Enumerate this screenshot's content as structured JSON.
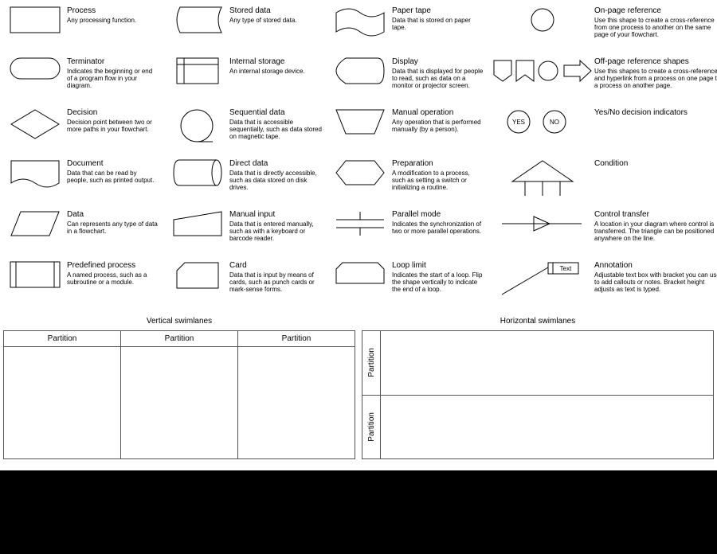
{
  "col1": [
    {
      "title": "Process",
      "desc": "Any processing function."
    },
    {
      "title": "Terminator",
      "desc": "Indicates the beginning or end of a program flow in your diagram."
    },
    {
      "title": "Decision",
      "desc": "Decision point between two or more paths in your flowchart."
    },
    {
      "title": "Document",
      "desc": "Data that can be read by people, such as printed output."
    },
    {
      "title": "Data",
      "desc": "Can represents any type of data in a flowchart."
    },
    {
      "title": "Predefined process",
      "desc": "A named process, such as a subroutine or a module."
    }
  ],
  "col2": [
    {
      "title": "Stored data",
      "desc": "Any type of stored data."
    },
    {
      "title": "Internal storage",
      "desc": "An internal storage device."
    },
    {
      "title": "Sequential data",
      "desc": "Data that is accessible sequentially, such as data stored on magnetic tape."
    },
    {
      "title": "Direct data",
      "desc": "Data that is directly accessible, such as data stored on disk drives."
    },
    {
      "title": "Manual input",
      "desc": "Data that is entered manually, such as with a keyboard or barcode reader."
    },
    {
      "title": "Card",
      "desc": "Data that is input by means of cards, such as punch cards or mark-sense forms."
    }
  ],
  "col3": [
    {
      "title": "Paper tape",
      "desc": "Data that is stored on paper tape."
    },
    {
      "title": "Display",
      "desc": "Data that is displayed for people to read, such as data on a monitor or projector screen."
    },
    {
      "title": "Manual operation",
      "desc": "Any operation that is performed manually (by a person)."
    },
    {
      "title": "Preparation",
      "desc": "A modification to a process, such as setting a switch or initializing a routine."
    },
    {
      "title": "Parallel mode",
      "desc": "Indicates the synchronization of two or more parallel operations."
    },
    {
      "title": "Loop limit",
      "desc": "Indicates the start of a loop. Flip the shape vertically to indicate the end of a loop."
    }
  ],
  "col4": [
    {
      "title": "On-page reference",
      "desc": "Use this shape to create a cross-reference from one process to another on the same page of your flowchart."
    },
    {
      "title": "Off-page reference shapes",
      "desc": "Use this shapes to create a cross-reference and hyperlink from a process on one page to a process on another page."
    },
    {
      "title": "Yes/No decision indicators",
      "desc": ""
    },
    {
      "title": "Condition",
      "desc": ""
    },
    {
      "title": "Control transfer",
      "desc": "A location in your diagram where control is transferred. The triangle can be positioned anywhere on the line."
    },
    {
      "title": "Annotation",
      "desc": "Adjustable text box with bracket you can use to add callouts or notes. Bracket height adjusts as text is typed."
    }
  ],
  "yes": "YES",
  "no": "NO",
  "text": "Text",
  "vswim_title": "Vertical swimlanes",
  "hswim_title": "Horizontal swimlanes",
  "partition": "Partition"
}
